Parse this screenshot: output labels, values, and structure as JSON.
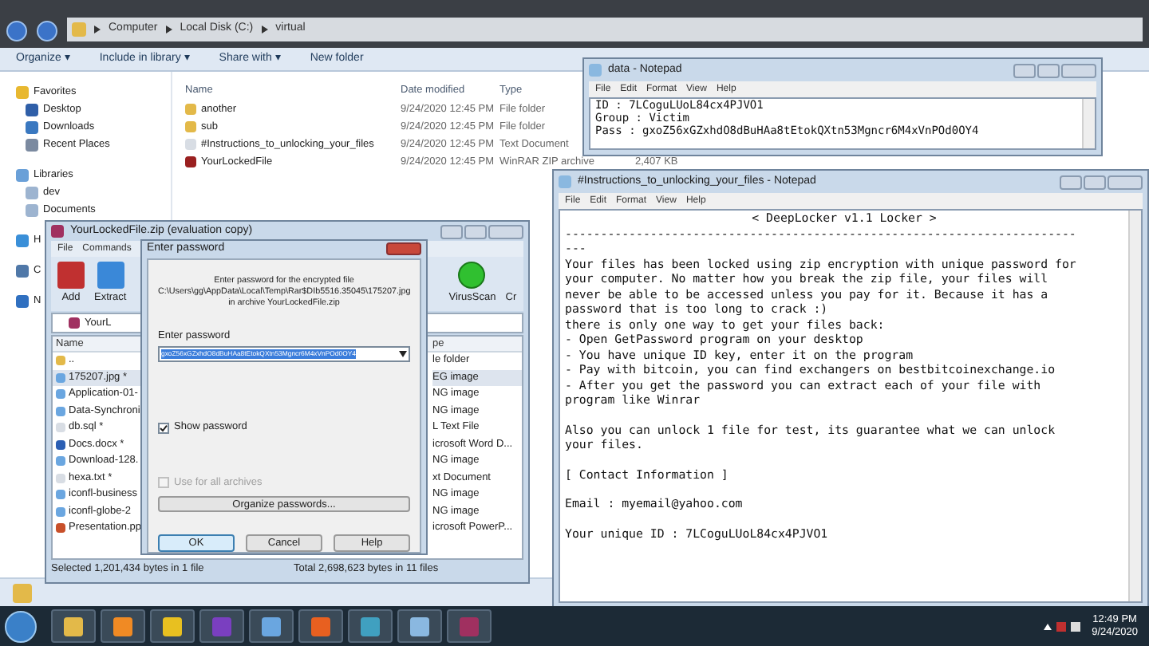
{
  "explorer": {
    "breadcrumb": [
      "Computer",
      "Local Disk (C:)",
      "virtual"
    ],
    "toolbar": [
      "Organize ▾",
      "Include in library ▾",
      "Share with ▾",
      "New folder"
    ],
    "sidebar": [
      {
        "label": "Favorites",
        "kind": "star"
      },
      {
        "label": "Desktop",
        "kind": "desktop"
      },
      {
        "label": "Downloads",
        "kind": "downloads"
      },
      {
        "label": "Recent Places",
        "kind": "recent"
      },
      {
        "label": "Libraries",
        "kind": "library"
      },
      {
        "label": "dev",
        "kind": "doc"
      },
      {
        "label": "Documents",
        "kind": "doc"
      },
      {
        "label": "H",
        "kind": "homegroup"
      },
      {
        "label": "C",
        "kind": "computer"
      },
      {
        "label": "N",
        "kind": "network"
      }
    ],
    "columns": [
      "Name",
      "Date modified",
      "Type"
    ],
    "rows": [
      {
        "name": "another",
        "date": "9/24/2020 12:45 PM",
        "type": "File folder",
        "kind": "folder"
      },
      {
        "name": "sub",
        "date": "9/24/2020 12:45 PM",
        "type": "File folder",
        "kind": "folder"
      },
      {
        "name": "#Instructions_to_unlocking_your_files",
        "date": "9/24/2020 12:45 PM",
        "type": "Text Document",
        "kind": "text"
      },
      {
        "name": "YourLockedFile",
        "date": "9/24/2020 12:45 PM",
        "type": "WinRAR ZIP archive",
        "size": "2,407 KB",
        "kind": "archive"
      }
    ]
  },
  "data_notepad": {
    "title": "data - Notepad",
    "menu": [
      "File",
      "Edit",
      "Format",
      "View",
      "Help"
    ],
    "lines": [
      "ID : 7LCoguLUoL84cx4PJVO1",
      "Group : Victim",
      "Pass : gxoZ56xGZxhdO8dBuHAa8tEtokQXtn53Mgncr6M4xVnPOd0OY4"
    ]
  },
  "instructions_notepad": {
    "title": "#Instructions_to_unlocking_your_files - Notepad",
    "menu": [
      "File",
      "Edit",
      "Format",
      "View",
      "Help"
    ],
    "header": "< DeepLocker v1.1 Locker >",
    "rule": "------------------------------------------------------------------------",
    "paragraphs": [
      [
        "---",
        "Your files has been locked using zip encryption with unique password for",
        "your computer. No matter how you break the zip file, your files will",
        "never be able to be accessed unless you pay for it. Because it has a",
        "password that is too long to crack :)",
        "there is only one way to get your files back:",
        "- Open GetPassword program on your desktop",
        "- You have unique ID key, enter it on the program",
        "- Pay with bitcoin, you can find exchangers on bestbitcoinexchange.io",
        "- After you get the password you can extract each of your file with",
        "program like Winrar"
      ],
      [
        "Also you can unlock 1 file for test, its guarantee what we can unlock",
        "your files."
      ],
      [
        "[ Contact Information ]"
      ],
      [
        "Email : myemail@yahoo.com"
      ],
      [
        "Your unique ID : 7LCoguLUoL84cx4PJVO1"
      ]
    ]
  },
  "winrar": {
    "title": "YourLockedFile.zip (evaluation copy)",
    "menu": [
      "File",
      "Commands"
    ],
    "tools": [
      {
        "label": "Add",
        "kind": "add"
      },
      {
        "label": "Extract",
        "kind": "extract"
      }
    ],
    "right_tools": [
      {
        "label": "VirusScan",
        "kind": "scan"
      },
      {
        "label": "Cr",
        "kind": "blank"
      }
    ],
    "path": "YourL",
    "name_header": "Name",
    "type_header": "pe",
    "files": [
      {
        "name": "..",
        "type": "le folder",
        "kind": "folder",
        "selected": false
      },
      {
        "name": "175207.jpg *",
        "type": "EG image",
        "kind": "image",
        "selected": true
      },
      {
        "name": "Application-01-",
        "type": "NG image",
        "kind": "image",
        "selected": false
      },
      {
        "name": "Data-Synchroni",
        "type": "NG image",
        "kind": "image",
        "selected": false
      },
      {
        "name": "db.sql *",
        "type": "L Text File",
        "kind": "text",
        "selected": false
      },
      {
        "name": "Docs.docx *",
        "type": "icrosoft Word D...",
        "kind": "word",
        "selected": false
      },
      {
        "name": "Download-128.",
        "type": "NG image",
        "kind": "image",
        "selected": false
      },
      {
        "name": "hexa.txt *",
        "type": "xt Document",
        "kind": "text",
        "selected": false
      },
      {
        "name": "iconfl-business",
        "type": "NG image",
        "kind": "image",
        "selected": false
      },
      {
        "name": "iconfl-globe-2",
        "type": "NG image",
        "kind": "image",
        "selected": false
      },
      {
        "name": "Presentation.pp",
        "type": "icrosoft PowerP...",
        "kind": "ppt",
        "selected": false
      }
    ],
    "status_left": "Selected 1,201,434 bytes in 1 file",
    "status_right": "Total 2,698,623 bytes in 11 files"
  },
  "password_dialog": {
    "title": "Enter password",
    "intro": [
      "Enter password for the encrypted file",
      "C:\\Users\\gg\\AppData\\Local\\Temp\\Rar$DIb5516.35045\\175207.jpg",
      "in archive YourLockedFile.zip"
    ],
    "field_label": "Enter password",
    "value": "gxoZ56xGZxhdO8dBuHAa8tEtokQXtn53Mgncr6M4xVnPOd0OY4",
    "show_password": {
      "label": "Show password",
      "checked": true
    },
    "all_archives": {
      "label": "Use for all archives",
      "checked": false,
      "disabled": true
    },
    "organize": "Organize passwords...",
    "buttons": [
      "OK",
      "Cancel",
      "Help"
    ]
  },
  "taskbar": {
    "apps": [
      {
        "kind": "folder"
      },
      {
        "kind": "sublime"
      },
      {
        "kind": "cart"
      },
      {
        "kind": "vs"
      },
      {
        "kind": "image"
      },
      {
        "kind": "firefox"
      },
      {
        "kind": "dots"
      },
      {
        "kind": "note"
      },
      {
        "kind": "rar"
      }
    ],
    "time": "12:49 PM",
    "date": "9/24/2020"
  }
}
